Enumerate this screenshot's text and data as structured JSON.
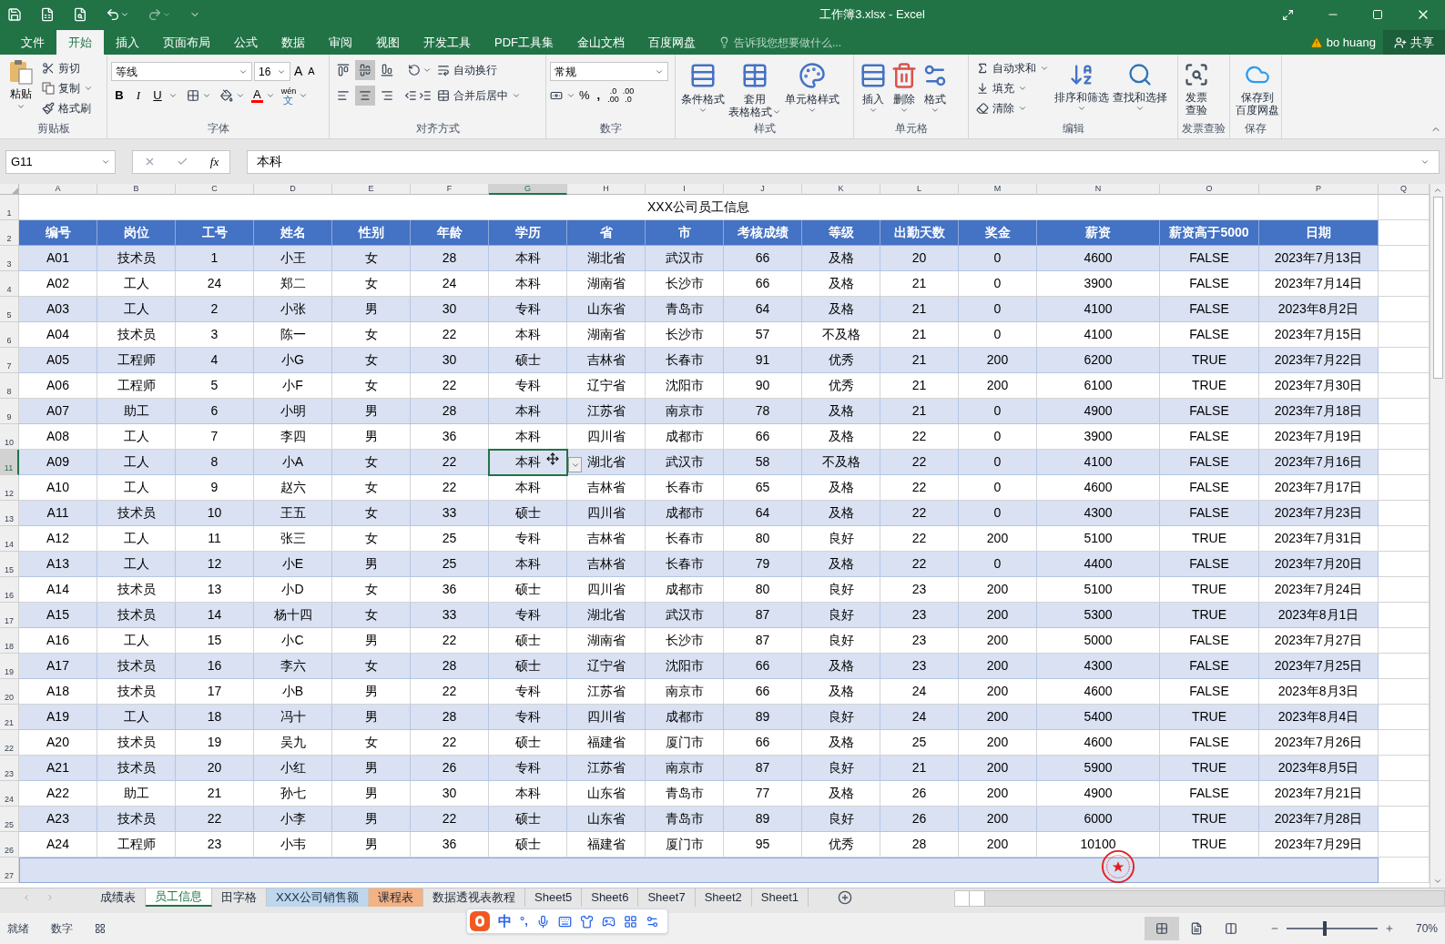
{
  "window": {
    "title": "工作簿3.xlsx - Excel"
  },
  "menu_tabs": [
    {
      "label": "文件",
      "selected": false
    },
    {
      "label": "开始",
      "selected": true
    },
    {
      "label": "插入",
      "selected": false
    },
    {
      "label": "页面布局",
      "selected": false
    },
    {
      "label": "公式",
      "selected": false
    },
    {
      "label": "数据",
      "selected": false
    },
    {
      "label": "审阅",
      "selected": false
    },
    {
      "label": "视图",
      "selected": false
    },
    {
      "label": "开发工具",
      "selected": false
    },
    {
      "label": "PDF工具集",
      "selected": false
    },
    {
      "label": "金山文档",
      "selected": false
    },
    {
      "label": "百度网盘",
      "selected": false
    }
  ],
  "tell_me": {
    "placeholder": "告诉我您想要做什么..."
  },
  "user": {
    "name": "bo huang"
  },
  "share_button": "共享",
  "ribbon": {
    "clipboard": {
      "label": "剪贴板",
      "paste": "粘贴",
      "cut": "剪切",
      "copy": "复制",
      "painter": "格式刷"
    },
    "font": {
      "label": "字体",
      "family": "等线",
      "size": "16",
      "grow": "A",
      "shrink": "A",
      "bold": "B",
      "italic": "I",
      "underline": "U",
      "color_letter": "A",
      "phonetic": "wén",
      "phonetic_char": "文"
    },
    "alignment": {
      "label": "对齐方式",
      "wrap": "自动换行",
      "merge": "合并后居中",
      "valign": [
        {
          "selected": false
        },
        {
          "selected": true
        },
        {
          "selected": false
        }
      ],
      "halign": [
        {
          "selected": false
        },
        {
          "selected": true
        },
        {
          "selected": false
        }
      ]
    },
    "number": {
      "label": "数字",
      "format": "常规",
      "percent": "%",
      "comma": ",",
      "inc_top": ".0",
      "inc_bottom": ".00",
      "dec_top": ".00",
      "dec_bottom": ".0"
    },
    "styles": {
      "label": "样式",
      "buttons": [
        {
          "kind": "conditional",
          "lines": [
            "条件格式"
          ]
        },
        {
          "kind": "table",
          "lines": [
            "套用",
            "表格格式"
          ]
        },
        {
          "kind": "cellstyle",
          "lines": [
            "单元格样式"
          ]
        }
      ]
    },
    "cells": {
      "label": "单元格",
      "buttons": [
        {
          "kind": "insert",
          "lines": [
            "插入"
          ]
        },
        {
          "kind": "delete",
          "lines": [
            "删除"
          ]
        },
        {
          "kind": "format",
          "lines": [
            "格式"
          ]
        }
      ]
    },
    "editing": {
      "label": "编辑",
      "autosum": "自动求和",
      "fill": "填充",
      "clear": "清除",
      "sort": "排序和筛选",
      "find": "查找和选择"
    },
    "invoice": {
      "label": "发票查验",
      "lines": [
        "发票",
        "查验"
      ]
    },
    "save": {
      "label": "保存",
      "lines": [
        "保存到",
        "百度网盘"
      ]
    }
  },
  "formula_bar": {
    "name_box": "G11",
    "fx": "fx",
    "value": "本科"
  },
  "sheet": {
    "columns": [
      {
        "letter": "A",
        "selected": false
      },
      {
        "letter": "B",
        "selected": false
      },
      {
        "letter": "C",
        "selected": false
      },
      {
        "letter": "D",
        "selected": false
      },
      {
        "letter": "E",
        "selected": false
      },
      {
        "letter": "F",
        "selected": false
      },
      {
        "letter": "G",
        "selected": true
      },
      {
        "letter": "H",
        "selected": false
      },
      {
        "letter": "I",
        "selected": false
      },
      {
        "letter": "J",
        "selected": false
      },
      {
        "letter": "K",
        "selected": false
      },
      {
        "letter": "L",
        "selected": false
      },
      {
        "letter": "M",
        "selected": false
      },
      {
        "letter": "N",
        "selected": false
      },
      {
        "letter": "O",
        "selected": false
      },
      {
        "letter": "P",
        "selected": false
      },
      {
        "letter": "Q",
        "selected": false
      }
    ],
    "rows": [
      {
        "number": "1",
        "kind": "title",
        "text": "XXX公司员工信息"
      },
      {
        "number": "2",
        "kind": "header",
        "cells": [
          "编号",
          "岗位",
          "工号",
          "姓名",
          "性别",
          "年龄",
          "学历",
          "省",
          "市",
          "考核成绩",
          "等级",
          "出勤天数",
          "奖金",
          "薪资",
          "薪资高于5000",
          "日期"
        ]
      },
      {
        "number": "3",
        "kind": "data",
        "banded": true,
        "selected": false,
        "cells": [
          "A01",
          "技术员",
          "1",
          "小王",
          "女",
          "28",
          "本科",
          "湖北省",
          "武汉市",
          "66",
          "及格",
          "20",
          "0",
          "4600",
          "FALSE",
          "2023年7月13日"
        ]
      },
      {
        "number": "4",
        "kind": "data",
        "banded": false,
        "selected": false,
        "cells": [
          "A02",
          "工人",
          "24",
          "郑二",
          "女",
          "24",
          "本科",
          "湖南省",
          "长沙市",
          "66",
          "及格",
          "21",
          "0",
          "3900",
          "FALSE",
          "2023年7月14日"
        ]
      },
      {
        "number": "5",
        "kind": "data",
        "banded": true,
        "selected": false,
        "cells": [
          "A03",
          "工人",
          "2",
          "小张",
          "男",
          "30",
          "专科",
          "山东省",
          "青岛市",
          "64",
          "及格",
          "21",
          "0",
          "4100",
          "FALSE",
          "2023年8月2日"
        ]
      },
      {
        "number": "6",
        "kind": "data",
        "banded": false,
        "selected": false,
        "cells": [
          "A04",
          "技术员",
          "3",
          "陈一",
          "女",
          "22",
          "本科",
          "湖南省",
          "长沙市",
          "57",
          "不及格",
          "21",
          "0",
          "4100",
          "FALSE",
          "2023年7月15日"
        ]
      },
      {
        "number": "7",
        "kind": "data",
        "banded": true,
        "selected": false,
        "cells": [
          "A05",
          "工程师",
          "4",
          "小G",
          "女",
          "30",
          "硕士",
          "吉林省",
          "长春市",
          "91",
          "优秀",
          "21",
          "200",
          "6200",
          "TRUE",
          "2023年7月22日"
        ]
      },
      {
        "number": "8",
        "kind": "data",
        "banded": false,
        "selected": false,
        "cells": [
          "A06",
          "工程师",
          "5",
          "小F",
          "女",
          "22",
          "专科",
          "辽宁省",
          "沈阳市",
          "90",
          "优秀",
          "21",
          "200",
          "6100",
          "TRUE",
          "2023年7月30日"
        ]
      },
      {
        "number": "9",
        "kind": "data",
        "banded": true,
        "selected": false,
        "cells": [
          "A07",
          "助工",
          "6",
          "小明",
          "男",
          "28",
          "本科",
          "江苏省",
          "南京市",
          "78",
          "及格",
          "21",
          "0",
          "4900",
          "FALSE",
          "2023年7月18日"
        ]
      },
      {
        "number": "10",
        "kind": "data",
        "banded": false,
        "selected": false,
        "cells": [
          "A08",
          "工人",
          "7",
          "李四",
          "男",
          "36",
          "本科",
          "四川省",
          "成都市",
          "66",
          "及格",
          "22",
          "0",
          "3900",
          "FALSE",
          "2023年7月19日"
        ]
      },
      {
        "number": "11",
        "kind": "data",
        "banded": true,
        "selected": true,
        "cells": [
          "A09",
          "工人",
          "8",
          "小A",
          "女",
          "22",
          "本科",
          "湖北省",
          "武汉市",
          "58",
          "不及格",
          "22",
          "0",
          "4100",
          "FALSE",
          "2023年7月16日"
        ]
      },
      {
        "number": "12",
        "kind": "data",
        "banded": false,
        "selected": false,
        "cells": [
          "A10",
          "工人",
          "9",
          "赵六",
          "女",
          "22",
          "本科",
          "吉林省",
          "长春市",
          "65",
          "及格",
          "22",
          "0",
          "4600",
          "FALSE",
          "2023年7月17日"
        ]
      },
      {
        "number": "13",
        "kind": "data",
        "banded": true,
        "selected": false,
        "cells": [
          "A11",
          "技术员",
          "10",
          "王五",
          "女",
          "33",
          "硕士",
          "四川省",
          "成都市",
          "64",
          "及格",
          "22",
          "0",
          "4300",
          "FALSE",
          "2023年7月23日"
        ]
      },
      {
        "number": "14",
        "kind": "data",
        "banded": false,
        "selected": false,
        "cells": [
          "A12",
          "工人",
          "11",
          "张三",
          "女",
          "25",
          "专科",
          "吉林省",
          "长春市",
          "80",
          "良好",
          "22",
          "200",
          "5100",
          "TRUE",
          "2023年7月31日"
        ]
      },
      {
        "number": "15",
        "kind": "data",
        "banded": true,
        "selected": false,
        "cells": [
          "A13",
          "工人",
          "12",
          "小E",
          "男",
          "25",
          "本科",
          "吉林省",
          "长春市",
          "79",
          "及格",
          "22",
          "0",
          "4400",
          "FALSE",
          "2023年7月20日"
        ]
      },
      {
        "number": "16",
        "kind": "data",
        "banded": false,
        "selected": false,
        "cells": [
          "A14",
          "技术员",
          "13",
          "小D",
          "女",
          "36",
          "硕士",
          "四川省",
          "成都市",
          "80",
          "良好",
          "23",
          "200",
          "5100",
          "TRUE",
          "2023年7月24日"
        ]
      },
      {
        "number": "17",
        "kind": "data",
        "banded": true,
        "selected": false,
        "cells": [
          "A15",
          "技术员",
          "14",
          "杨十四",
          "女",
          "33",
          "专科",
          "湖北省",
          "武汉市",
          "87",
          "良好",
          "23",
          "200",
          "5300",
          "TRUE",
          "2023年8月1日"
        ]
      },
      {
        "number": "18",
        "kind": "data",
        "banded": false,
        "selected": false,
        "cells": [
          "A16",
          "工人",
          "15",
          "小C",
          "男",
          "22",
          "硕士",
          "湖南省",
          "长沙市",
          "87",
          "良好",
          "23",
          "200",
          "5000",
          "FALSE",
          "2023年7月27日"
        ]
      },
      {
        "number": "19",
        "kind": "data",
        "banded": true,
        "selected": false,
        "cells": [
          "A17",
          "技术员",
          "16",
          "李六",
          "女",
          "28",
          "硕士",
          "辽宁省",
          "沈阳市",
          "66",
          "及格",
          "23",
          "200",
          "4300",
          "FALSE",
          "2023年7月25日"
        ]
      },
      {
        "number": "20",
        "kind": "data",
        "banded": false,
        "selected": false,
        "cells": [
          "A18",
          "技术员",
          "17",
          "小B",
          "男",
          "22",
          "专科",
          "江苏省",
          "南京市",
          "66",
          "及格",
          "24",
          "200",
          "4600",
          "FALSE",
          "2023年8月3日"
        ]
      },
      {
        "number": "21",
        "kind": "data",
        "banded": true,
        "selected": false,
        "cells": [
          "A19",
          "工人",
          "18",
          "冯十",
          "男",
          "28",
          "专科",
          "四川省",
          "成都市",
          "89",
          "良好",
          "24",
          "200",
          "5400",
          "TRUE",
          "2023年8月4日"
        ]
      },
      {
        "number": "22",
        "kind": "data",
        "banded": false,
        "selected": false,
        "cells": [
          "A20",
          "技术员",
          "19",
          "吴九",
          "女",
          "22",
          "硕士",
          "福建省",
          "厦门市",
          "66",
          "及格",
          "25",
          "200",
          "4600",
          "FALSE",
          "2023年7月26日"
        ]
      },
      {
        "number": "23",
        "kind": "data",
        "banded": true,
        "selected": false,
        "cells": [
          "A21",
          "技术员",
          "20",
          "小红",
          "男",
          "26",
          "专科",
          "江苏省",
          "南京市",
          "87",
          "良好",
          "21",
          "200",
          "5900",
          "TRUE",
          "2023年8月5日"
        ]
      },
      {
        "number": "24",
        "kind": "data",
        "banded": false,
        "selected": false,
        "cells": [
          "A22",
          "助工",
          "21",
          "孙七",
          "男",
          "30",
          "本科",
          "山东省",
          "青岛市",
          "77",
          "及格",
          "26",
          "200",
          "4900",
          "FALSE",
          "2023年7月21日"
        ]
      },
      {
        "number": "25",
        "kind": "data",
        "banded": true,
        "selected": false,
        "cells": [
          "A23",
          "技术员",
          "22",
          "小李",
          "男",
          "22",
          "硕士",
          "山东省",
          "青岛市",
          "89",
          "良好",
          "26",
          "200",
          "6000",
          "TRUE",
          "2023年7月28日"
        ]
      },
      {
        "number": "26",
        "kind": "data",
        "banded": false,
        "selected": false,
        "cells": [
          "A24",
          "工程师",
          "23",
          "小韦",
          "男",
          "36",
          "硕士",
          "福建省",
          "厦门市",
          "95",
          "优秀",
          "28",
          "200",
          "10100",
          "TRUE",
          "2023年7月29日"
        ]
      },
      {
        "number": "27",
        "kind": "blank",
        "banded": true
      }
    ]
  },
  "sheet_tabs": [
    {
      "label": "成绩表",
      "selected": false
    },
    {
      "label": "员工信息",
      "selected": true
    },
    {
      "label": "田字格",
      "selected": false
    },
    {
      "label": "XXX公司销售额",
      "selected": false,
      "color": "#bdd7ee"
    },
    {
      "label": "课程表",
      "selected": false,
      "color": "#f4b183"
    },
    {
      "label": "数据透视表教程",
      "selected": false
    },
    {
      "label": "Sheet5",
      "selected": false
    },
    {
      "label": "Sheet6",
      "selected": false
    },
    {
      "label": "Sheet7",
      "selected": false
    },
    {
      "label": "Sheet2",
      "selected": false
    },
    {
      "label": "Sheet1",
      "selected": false
    }
  ],
  "ime": {
    "lang": "中",
    "punct": "°,"
  },
  "status_bar": {
    "ready": "就绪",
    "mode": "数字",
    "views": [
      {
        "kind": "normal",
        "selected": true
      },
      {
        "kind": "layout",
        "selected": false
      },
      {
        "kind": "break",
        "selected": false
      }
    ],
    "zoom": {
      "level": 0.4,
      "reading": "70%"
    }
  }
}
